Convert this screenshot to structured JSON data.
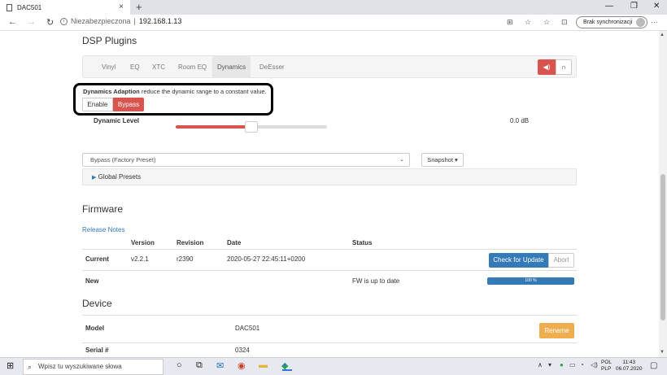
{
  "browser": {
    "tab_title": "DAC501",
    "tab_close": "×",
    "new_tab": "+",
    "minimize": "—",
    "maximize": "❐",
    "close": "✕",
    "back": "←",
    "forward": "→",
    "reload": "↻",
    "security_label": "Niezabezpieczona",
    "separator": "|",
    "url": "192.168.1.13",
    "sync_label": "Brak synchronizacji",
    "more": "···"
  },
  "dsp": {
    "heading": "DSP Plugins",
    "tabs": [
      {
        "label": "Vinyl"
      },
      {
        "label": "EQ"
      },
      {
        "label": "XTC"
      },
      {
        "label": "Room EQ"
      },
      {
        "label": "Dynamics"
      },
      {
        "label": "DeEsser"
      }
    ],
    "active_tab": "Dynamics",
    "speaker_button_icon": "speaker-icon",
    "headphones_button_icon": "headphones-icon",
    "dynamics_title": "Dynamics Adaption",
    "dynamics_desc": " reduce the dynamic range to a constant value.",
    "enable_label": "Enable",
    "bypass_label": "Bypass",
    "level_label": "Dynamic Level",
    "level_value": "0.0 dB",
    "level_fraction": 0.5,
    "preset_selected": "Bypass (Factory Preset)",
    "snapshot_label": "Snapshot ▾",
    "global_presets_label": "Global Presets"
  },
  "firmware": {
    "heading": "Firmware",
    "release_notes": "Release Notes",
    "columns": [
      "Version",
      "Revision",
      "Date",
      "Status"
    ],
    "current_label": "Current",
    "current_version": "v2.2.1",
    "current_revision": "r2390",
    "current_date": "2020-05-27 22:45:11+0200",
    "check_button": "Check for Update",
    "abort_button": "Abort",
    "new_label": "New",
    "status_text": "FW is up to date",
    "progress_label": "100 %",
    "progress_fraction": 1.0
  },
  "device": {
    "heading": "Device",
    "model_label": "Model",
    "model_value": "DAC501",
    "rename_button": "Rename",
    "serial_label": "Serial #",
    "serial_value": "0324"
  },
  "taskbar": {
    "search_placeholder": "Wpisz tu wyszukiwane słowa",
    "lang_line1": "POL",
    "lang_line2": "PLP",
    "time": "11:43",
    "date": "06.07.2020"
  },
  "colors": {
    "danger": "#d9534f",
    "primary": "#337ab7",
    "warning": "#f0ad4e"
  }
}
